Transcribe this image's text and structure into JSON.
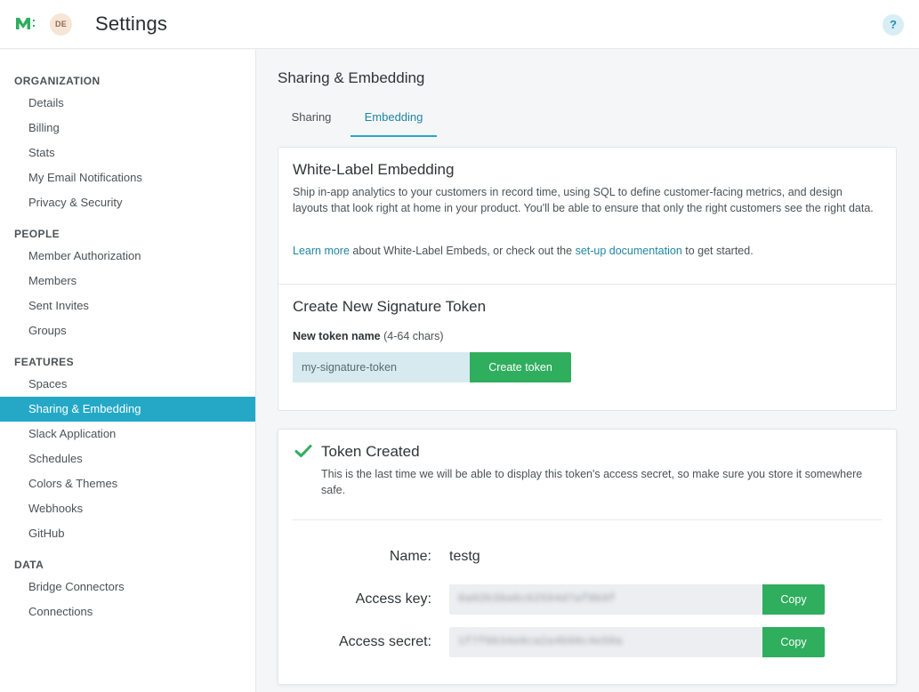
{
  "header": {
    "avatar_initials": "DE",
    "title": "Settings",
    "help_label": "?"
  },
  "sidebar": {
    "sections": [
      {
        "label": "ORGANIZATION"
      },
      {
        "label": "PEOPLE"
      },
      {
        "label": "FEATURES"
      },
      {
        "label": "DATA"
      }
    ],
    "items": [
      {
        "label": "Details"
      },
      {
        "label": "Billing"
      },
      {
        "label": "Stats"
      },
      {
        "label": "My Email Notifications"
      },
      {
        "label": "Privacy & Security"
      },
      {
        "label": "Member Authorization"
      },
      {
        "label": "Members"
      },
      {
        "label": "Sent Invites"
      },
      {
        "label": "Groups"
      },
      {
        "label": "Spaces"
      },
      {
        "label": "Sharing & Embedding",
        "active": true
      },
      {
        "label": "Slack Application"
      },
      {
        "label": "Schedules"
      },
      {
        "label": "Colors & Themes"
      },
      {
        "label": "Webhooks"
      },
      {
        "label": "GitHub"
      },
      {
        "label": "Bridge Connectors"
      },
      {
        "label": "Connections"
      }
    ],
    "active_color": "#25a8c6"
  },
  "main": {
    "title": "Sharing & Embedding",
    "tabs": [
      {
        "label": "Sharing"
      },
      {
        "label": "Embedding",
        "selected": true
      }
    ],
    "white_label": {
      "heading": "White-Label Embedding",
      "description": "Ship in-app analytics to your customers in record time, using SQL to define customer-facing metrics, and design layouts that look right at home in your product. You'll be able to ensure that only the right customers see the right data.",
      "learn_more_link": "Learn more",
      "middle_text": " about White-Label Embeds, or check out the ",
      "docs_link": "set-up documentation",
      "end_text": " to get started."
    },
    "create_token": {
      "heading": "Create New Signature Token",
      "field_label": "New token name",
      "field_hint": " (4-64 chars)",
      "input_value": "my-signature-token",
      "button_label": "Create token"
    },
    "token_created": {
      "heading": "Token Created",
      "message": "This is the last time we will be able to display this token's access secret, so make sure you store it somewhere safe.",
      "name_label": "Name:",
      "name_value": "testg",
      "access_key_label": "Access key:",
      "access_secret_label": "Access secret:",
      "copy_label": "Copy"
    }
  },
  "colors": {
    "accent": "#25a8c6",
    "success": "#2fae5e",
    "link": "#1f86a3"
  }
}
